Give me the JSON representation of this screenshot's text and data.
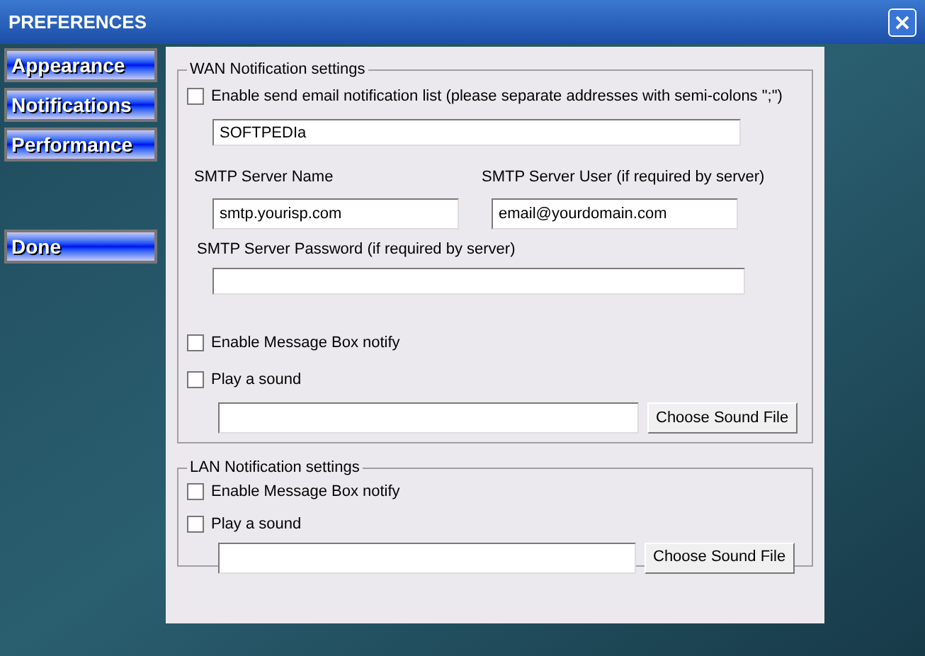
{
  "window": {
    "title": "PREFERENCES"
  },
  "sidebar": {
    "items": [
      "Appearance",
      "Notifications",
      "Performance"
    ],
    "done_button": "Done"
  },
  "wan": {
    "title": "WAN Notification settings",
    "email_list": {
      "label": "Enable send email notification list (please separate addresses with semi-colons \";\")",
      "checked": false,
      "value": "SOFTPEDIa"
    },
    "smtp_server_name": {
      "label": "SMTP Server Name",
      "value": "smtp.yourisp.com"
    },
    "smtp_server_user": {
      "label": "SMTP Server User (if required by server)",
      "value": "email@yourdomain.com"
    },
    "smtp_server_password": {
      "label": "SMTP Server Password (if required by server)"
    },
    "message_box": {
      "label": "Enable Message Box notify",
      "checked": false
    },
    "play_sound": {
      "label": "Play a sound",
      "checked": false
    },
    "sound_file_button": "Choose Sound File"
  },
  "lan": {
    "title": "LAN Notification settings",
    "message_box": {
      "label": "Enable Message Box notify",
      "checked": false
    },
    "play_sound": {
      "label": "Play a sound",
      "checked": false
    },
    "sound_file_button": "Choose Sound File"
  }
}
